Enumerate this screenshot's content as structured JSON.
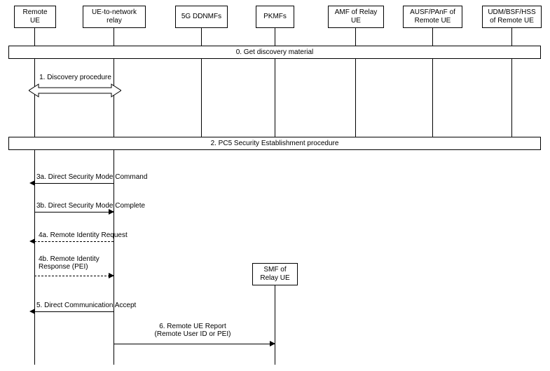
{
  "participants": {
    "remote_ue": "Remote\nUE",
    "relay": "UE-to-network\nrelay",
    "ddnmfs": "5G DDNMFs",
    "pkmfs": "PKMFs",
    "amf": "AMF of Relay\nUE",
    "ausf": "AUSF/PAnF of\nRemote UE",
    "udm": "UDM/BSF/HSS\nof Remote UE",
    "smf": "SMF of\nRelay UE"
  },
  "steps": {
    "s0": "0. Get discovery material",
    "s1": "1. Discovery procedure",
    "s2": "2. PC5 Security Establishment procedure",
    "s3a": "3a. Direct Security Mode Command",
    "s3b": "3b. Direct Security Mode Complete",
    "s4a": "4a. Remote Identity Request",
    "s4b": "4b. Remote Identity\nResponse (PEI)",
    "s5": "5. Direct Communication Accept",
    "s6": "6. Remote UE Report\n(Remote User ID or PEI)"
  }
}
